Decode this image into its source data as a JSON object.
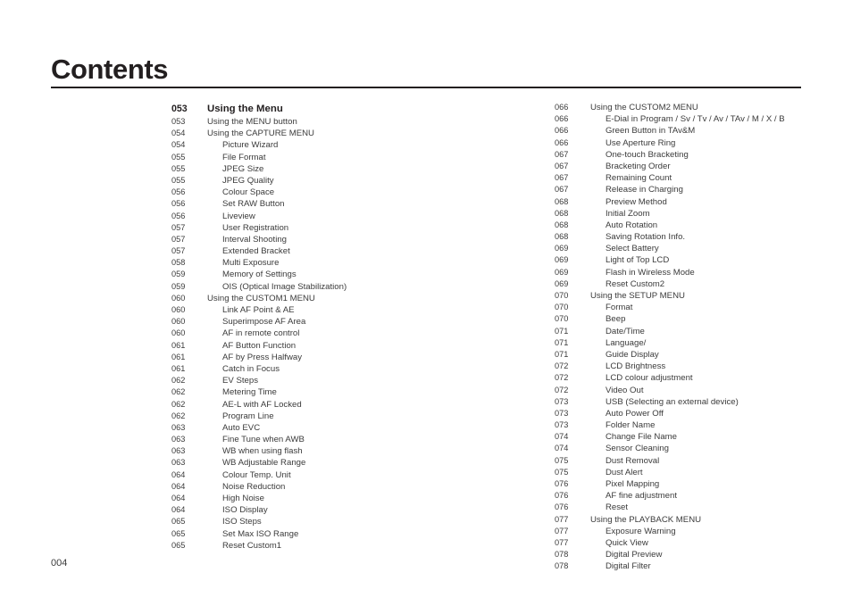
{
  "document": {
    "title": "Contents",
    "page_number": "004"
  },
  "toc": {
    "left_column": [
      {
        "page": "053",
        "label": "Using the Menu",
        "level": "h"
      },
      {
        "page": "053",
        "label": "Using the MENU button",
        "level": "1"
      },
      {
        "page": "054",
        "label": "Using the CAPTURE MENU",
        "level": "1"
      },
      {
        "page": "054",
        "label": "Picture Wizard",
        "level": "2"
      },
      {
        "page": "055",
        "label": "File Format",
        "level": "2"
      },
      {
        "page": "055",
        "label": "JPEG Size",
        "level": "2"
      },
      {
        "page": "055",
        "label": "JPEG Quality",
        "level": "2"
      },
      {
        "page": "056",
        "label": "Colour Space",
        "level": "2"
      },
      {
        "page": "056",
        "label": "Set RAW Button",
        "level": "2"
      },
      {
        "page": "056",
        "label": "Liveview",
        "level": "2"
      },
      {
        "page": "057",
        "label": "User Registration",
        "level": "2"
      },
      {
        "page": "057",
        "label": "Interval Shooting",
        "level": "2"
      },
      {
        "page": "057",
        "label": "Extended Bracket",
        "level": "2"
      },
      {
        "page": "058",
        "label": "Multi Exposure",
        "level": "2"
      },
      {
        "page": "059",
        "label": "Memory of Settings",
        "level": "2"
      },
      {
        "page": "059",
        "label": "OIS (Optical Image Stabilization)",
        "level": "2"
      },
      {
        "page": "060",
        "label": "Using the CUSTOM1 MENU",
        "level": "1"
      },
      {
        "page": "060",
        "label": "Link AF Point & AE",
        "level": "2"
      },
      {
        "page": "060",
        "label": "Superimpose AF Area",
        "level": "2"
      },
      {
        "page": "060",
        "label": "AF in remote control",
        "level": "2"
      },
      {
        "page": "061",
        "label": "AF Button Function",
        "level": "2"
      },
      {
        "page": "061",
        "label": "AF by Press Halfway",
        "level": "2"
      },
      {
        "page": "061",
        "label": "Catch in Focus",
        "level": "2"
      },
      {
        "page": "062",
        "label": "EV Steps",
        "level": "2"
      },
      {
        "page": "062",
        "label": "Metering Time",
        "level": "2"
      },
      {
        "page": "062",
        "label": "AE-L with AF Locked",
        "level": "2"
      },
      {
        "page": "062",
        "label": "Program Line",
        "level": "2"
      },
      {
        "page": "063",
        "label": "Auto EVC",
        "level": "2"
      },
      {
        "page": "063",
        "label": "Fine Tune when AWB",
        "level": "2"
      },
      {
        "page": "063",
        "label": "WB when using flash",
        "level": "2"
      },
      {
        "page": "063",
        "label": "WB Adjustable Range",
        "level": "2"
      },
      {
        "page": "064",
        "label": "Colour Temp. Unit",
        "level": "2"
      },
      {
        "page": "064",
        "label": "Noise Reduction",
        "level": "2"
      },
      {
        "page": "064",
        "label": "High Noise",
        "level": "2"
      },
      {
        "page": "064",
        "label": "ISO Display",
        "level": "2"
      },
      {
        "page": "065",
        "label": "ISO Steps",
        "level": "2"
      },
      {
        "page": "065",
        "label": "Set Max ISO Range",
        "level": "2"
      },
      {
        "page": "065",
        "label": "Reset Custom1",
        "level": "2"
      }
    ],
    "right_column": [
      {
        "page": "066",
        "label": "Using the CUSTOM2 MENU",
        "level": "1"
      },
      {
        "page": "066",
        "label": "E-Dial in Program / Sv / Tv / Av / TAv / M / X / B",
        "level": "2"
      },
      {
        "page": "066",
        "label": "Green Button in TAv&M",
        "level": "2"
      },
      {
        "page": "066",
        "label": "Use Aperture Ring",
        "level": "2"
      },
      {
        "page": "067",
        "label": "One-touch Bracketing",
        "level": "2"
      },
      {
        "page": "067",
        "label": "Bracketing Order",
        "level": "2"
      },
      {
        "page": "067",
        "label": "Remaining Count",
        "level": "2"
      },
      {
        "page": "067",
        "label": "Release in Charging",
        "level": "2"
      },
      {
        "page": "068",
        "label": "Preview Method",
        "level": "2"
      },
      {
        "page": "068",
        "label": "Initial Zoom",
        "level": "2"
      },
      {
        "page": "068",
        "label": "Auto Rotation",
        "level": "2"
      },
      {
        "page": "068",
        "label": "Saving Rotation Info.",
        "level": "2"
      },
      {
        "page": "069",
        "label": "Select Battery",
        "level": "2"
      },
      {
        "page": "069",
        "label": "Light of Top LCD",
        "level": "2"
      },
      {
        "page": "069",
        "label": "Flash in Wireless Mode",
        "level": "2"
      },
      {
        "page": "069",
        "label": "Reset Custom2",
        "level": "2"
      },
      {
        "page": "070",
        "label": "Using the SETUP MENU",
        "level": "1"
      },
      {
        "page": "070",
        "label": "Format",
        "level": "2"
      },
      {
        "page": "070",
        "label": "Beep",
        "level": "2"
      },
      {
        "page": "071",
        "label": "Date/Time",
        "level": "2"
      },
      {
        "page": "071",
        "label": "Language/",
        "level": "2"
      },
      {
        "page": "071",
        "label": "Guide Display",
        "level": "2"
      },
      {
        "page": "072",
        "label": "LCD Brightness",
        "level": "2"
      },
      {
        "page": "072",
        "label": "LCD colour adjustment",
        "level": "2"
      },
      {
        "page": "072",
        "label": "Video Out",
        "level": "2"
      },
      {
        "page": "073",
        "label": "USB (Selecting an external device)",
        "level": "2"
      },
      {
        "page": "073",
        "label": "Auto Power Off",
        "level": "2"
      },
      {
        "page": "073",
        "label": "Folder Name",
        "level": "2"
      },
      {
        "page": "074",
        "label": "Change File Name",
        "level": "2"
      },
      {
        "page": "074",
        "label": "Sensor Cleaning",
        "level": "2"
      },
      {
        "page": "075",
        "label": "Dust Removal",
        "level": "2"
      },
      {
        "page": "075",
        "label": "Dust Alert",
        "level": "2"
      },
      {
        "page": "076",
        "label": "Pixel Mapping",
        "level": "2"
      },
      {
        "page": "076",
        "label": "AF fine adjustment",
        "level": "2"
      },
      {
        "page": "076",
        "label": "Reset",
        "level": "2"
      },
      {
        "page": "077",
        "label": "Using the PLAYBACK MENU",
        "level": "1"
      },
      {
        "page": "077",
        "label": "Exposure Warning",
        "level": "2"
      },
      {
        "page": "077",
        "label": "Quick View",
        "level": "2"
      },
      {
        "page": "078",
        "label": "Digital Preview",
        "level": "2"
      },
      {
        "page": "078",
        "label": "Digital Filter",
        "level": "2"
      }
    ]
  }
}
